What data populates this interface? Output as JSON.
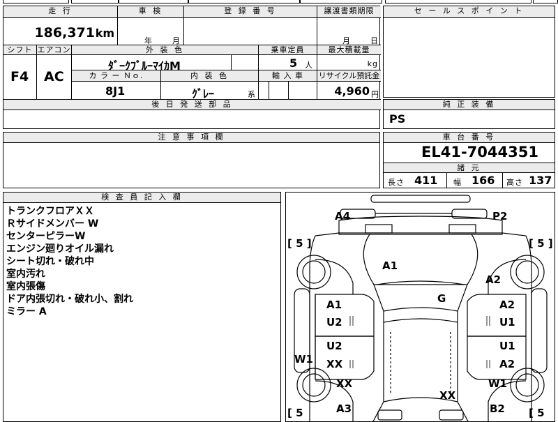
{
  "top_table": {
    "mileage": {
      "header": "走 行",
      "value": "186,371",
      "unit": "km"
    },
    "inspection": {
      "header": "車 検",
      "year_unit": "年",
      "month_unit": "月"
    },
    "registration": {
      "header": "登 録 番 号",
      "value": ""
    },
    "transfer_deadline": {
      "header": "譲渡書類期限",
      "month_unit": "月",
      "day_unit": "日"
    },
    "shift": {
      "header": "シフト",
      "value": "F4"
    },
    "aircon": {
      "header": "エアコン",
      "value": "AC"
    },
    "exterior_color": {
      "header": "外 装 色",
      "value": "ﾀﾞｰｸﾌﾞﾙｰﾏｲｶM"
    },
    "capacity": {
      "header": "乗車定員",
      "value": "5",
      "unit": "人"
    },
    "max_load": {
      "header": "最大積載量",
      "value": "",
      "unit": "kg"
    },
    "color_no": {
      "header": "カ ラ ー Ｎｏ.",
      "value": "8J1"
    },
    "interior_color": {
      "header": "内 装 色",
      "value": "ｸﾞﾚｰ",
      "suffix": "系"
    },
    "import": {
      "header": "輸 入 車",
      "value": ""
    },
    "recycle": {
      "header": "リサイクル預託金",
      "value": "4,960",
      "unit": "円"
    },
    "later_parts": {
      "header": "後 日 発 送 部 品",
      "value": ""
    }
  },
  "sales_point": {
    "header": "セ ー ル ス ポ イ ン ト",
    "value": ""
  },
  "genuine_equipment": {
    "header": "純 正 装 備",
    "value": "PS"
  },
  "caution": {
    "header": "注 意 事 項 欄",
    "value": ""
  },
  "chassis": {
    "header": "車 台 番 号",
    "value": "EL41-7044351"
  },
  "specs": {
    "header": "諸 元",
    "length_label": "長さ",
    "length": "411",
    "width_label": "幅",
    "width": "166",
    "height_label": "高さ",
    "height": "137"
  },
  "inspector": {
    "header": "検 査 員 記 入 欄",
    "notes": [
      "トランクフロアＸＸ",
      "Ｒサイドメンバー W",
      "センターピラーW",
      "エンジン廻りオイル漏れ",
      "シート切れ・破れ中",
      "室内汚れ",
      "室内張傷",
      "ドア内張切れ・破れ小、割れ",
      "ミラー A"
    ]
  },
  "diagram": {
    "labels": {
      "a4_tl": "A4",
      "p2_tr": "P2",
      "a1_trunk": "A1",
      "a2_right_quarter": "A2",
      "g_rear_glass": "G",
      "a1_left_rear_door": "A1",
      "u2_left_rear_door": "U2",
      "a2_right_rear_door": "A2",
      "u1_right_rear_door": "U1",
      "u2_left_front_door": "U2",
      "xx_left_front_door": "XX",
      "u1_right_front_door": "U1",
      "a2_right_front_door": "A2",
      "w1_left": "W1",
      "xx_left_fender": "XX",
      "w1_right": "W1",
      "xx_front": "XX",
      "a3_bl": "A3",
      "b2_br": "B2"
    },
    "tires": {
      "top_left": "[ 5 ]",
      "top_right": "[ 5 ]",
      "bottom_left": "[ 5",
      "bottom_right": "[ 5"
    }
  }
}
